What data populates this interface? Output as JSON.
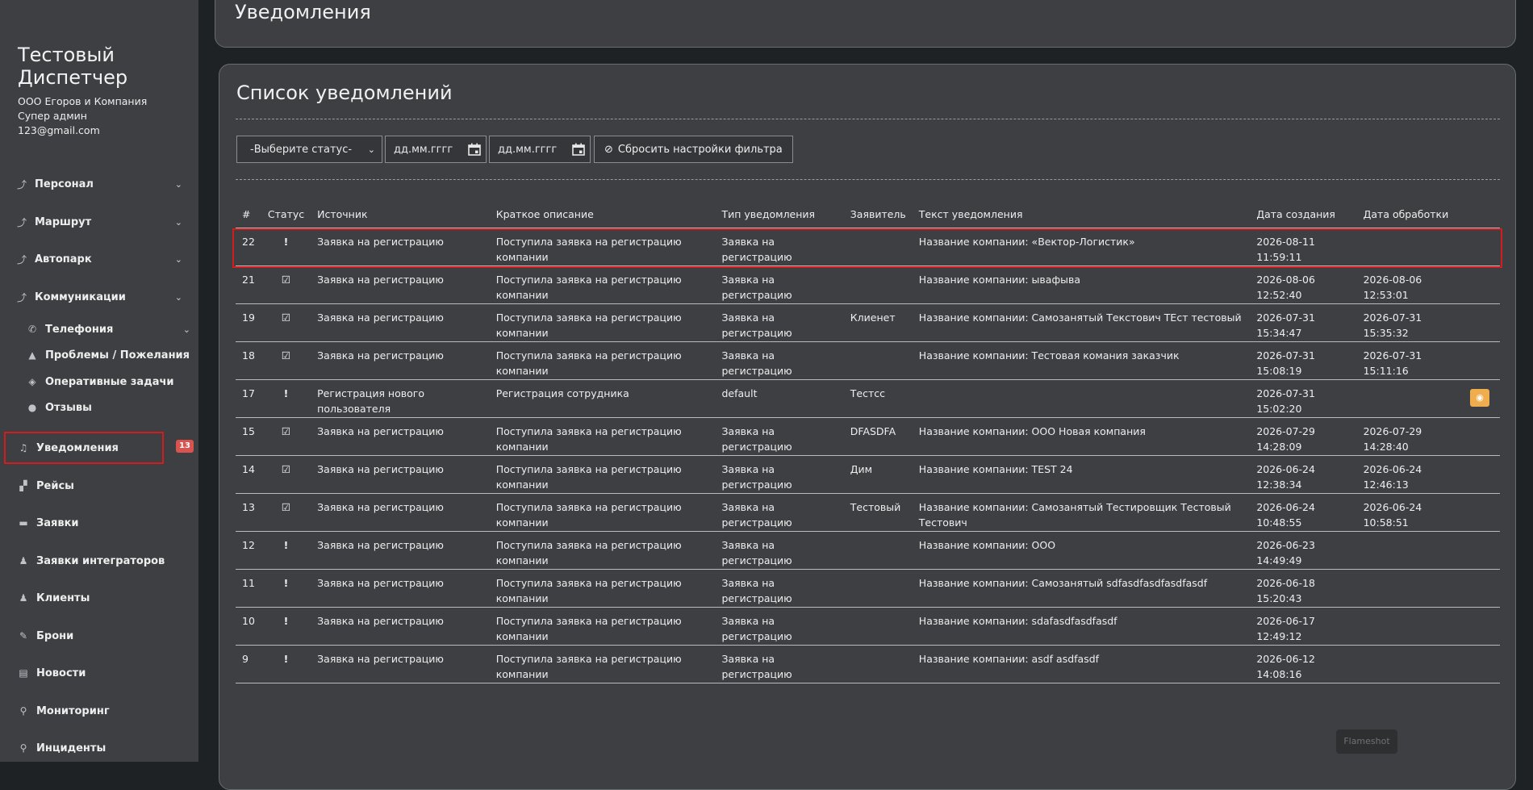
{
  "sidebar": {
    "title": "Тестовый Диспетчер",
    "company": "ООО Егоров и Компания",
    "role": "Супер админ",
    "email": "123@gmail.com",
    "items": [
      {
        "label": "Персонал",
        "icon": "arrow-up-icon"
      },
      {
        "label": "Маршрут",
        "icon": "arrow-up-icon"
      },
      {
        "label": "Автопарк",
        "icon": "arrow-up-icon"
      },
      {
        "label": "Коммуникации",
        "icon": "arrow-up-icon"
      },
      {
        "label": "Телефония",
        "icon": "phone-icon"
      },
      {
        "label": "Проблемы / Пожелания",
        "icon": "warning-icon"
      },
      {
        "label": "Оперативные задачи",
        "icon": "diamond-icon"
      },
      {
        "label": "Отзывы",
        "icon": "comment-icon"
      },
      {
        "label": "Уведомления",
        "icon": "bell-icon",
        "badge": "13"
      },
      {
        "label": "Рейсы",
        "icon": "road-icon"
      },
      {
        "label": "Заявки",
        "icon": "car-icon"
      },
      {
        "label": "Заявки интеграторов",
        "icon": "users-icon"
      },
      {
        "label": "Клиенты",
        "icon": "users-icon"
      },
      {
        "label": "Брони",
        "icon": "edit-icon"
      },
      {
        "label": "Новости",
        "icon": "newspaper-icon"
      },
      {
        "label": "Мониторинг",
        "icon": "map-marker-icon"
      },
      {
        "label": "Инциденты",
        "icon": "map-marker-icon"
      }
    ]
  },
  "header": {
    "title": "Уведомления"
  },
  "main": {
    "title": "Список уведомлений",
    "filters": {
      "status_select": "-Выберите статус-",
      "date_from": "дд.мм.гггг",
      "date_to": "дд.мм.гггг",
      "reset_label": "Сбросить настройки фильтра"
    },
    "table": {
      "columns": [
        "#",
        "Статус",
        "Источник",
        "Краткое описание",
        "Тип уведомления",
        "Заявитель",
        "Текст уведомления",
        "Дата создания",
        "Дата обработки"
      ],
      "rows": [
        {
          "id": "22",
          "status": "new",
          "source": "Заявка на регистрацию",
          "desc": "Поступила заявка на регистрацию компании",
          "type": "Заявка на регистрацию",
          "applicant": "",
          "text": "Название компании: «Вектор-Логистик»",
          "created": "2026-08-11 11:59:11",
          "processed": ""
        },
        {
          "id": "21",
          "status": "done",
          "source": "Заявка на регистрацию",
          "desc": "Поступила заявка на регистрацию компании",
          "type": "Заявка на регистрацию",
          "applicant": "",
          "text": "Название компании: ывафыва",
          "created": "2026-08-06 12:52:40",
          "processed": "2026-08-06 12:53:01"
        },
        {
          "id": "19",
          "status": "done",
          "source": "Заявка на регистрацию",
          "desc": "Поступила заявка на регистрацию компании",
          "type": "Заявка на регистрацию",
          "applicant": "Клиенет",
          "text": "Название компании: Самозанятый Текстович ТЕст тестовый",
          "created": "2026-07-31 15:34:47",
          "processed": "2026-07-31 15:35:32"
        },
        {
          "id": "18",
          "status": "done",
          "source": "Заявка на регистрацию",
          "desc": "Поступила заявка на регистрацию компании",
          "type": "Заявка на регистрацию",
          "applicant": "",
          "text": "Название компании: Тестовая комания заказчик",
          "created": "2026-07-31 15:08:19",
          "processed": "2026-07-31 15:11:16"
        },
        {
          "id": "17",
          "status": "new",
          "source": "Регистрация нового пользователя",
          "desc": "Регистрация сотрудника",
          "type": "default",
          "applicant": "Тестсс",
          "text": "",
          "created": "2026-07-31 15:02:20",
          "processed": "",
          "action": true
        },
        {
          "id": "15",
          "status": "done",
          "source": "Заявка на регистрацию",
          "desc": "Поступила заявка на регистрацию компании",
          "type": "Заявка на регистрацию",
          "applicant": "DFASDFA",
          "text": "Название компании: ООО Новая компания",
          "created": "2026-07-29 14:28:09",
          "processed": "2026-07-29 14:28:40"
        },
        {
          "id": "14",
          "status": "done",
          "source": "Заявка на регистрацию",
          "desc": "Поступила заявка на регистрацию компании",
          "type": "Заявка на регистрацию",
          "applicant": "Дим",
          "text": "Название компании: TEST 24",
          "created": "2026-06-24 12:38:34",
          "processed": "2026-06-24 12:46:13"
        },
        {
          "id": "13",
          "status": "done",
          "source": "Заявка на регистрацию",
          "desc": "Поступила заявка на регистрацию компании",
          "type": "Заявка на регистрацию",
          "applicant": "Тестовый",
          "text": "Название компании: Самозанятый Тестировщик Тестовый Тестович",
          "created": "2026-06-24 10:48:55",
          "processed": "2026-06-24 10:58:51"
        },
        {
          "id": "12",
          "status": "new",
          "source": "Заявка на регистрацию",
          "desc": "Поступила заявка на регистрацию компании",
          "type": "Заявка на регистрацию",
          "applicant": "",
          "text": "Название компании: ООО",
          "created": "2026-06-23 14:49:49",
          "processed": ""
        },
        {
          "id": "11",
          "status": "new",
          "source": "Заявка на регистрацию",
          "desc": "Поступила заявка на регистрацию компании",
          "type": "Заявка на регистрацию",
          "applicant": "",
          "text": "Название компании: Самозанятый sdfasdfasdfasdfasdf",
          "created": "2026-06-18 15:20:43",
          "processed": ""
        },
        {
          "id": "10",
          "status": "new",
          "source": "Заявка на регистрацию",
          "desc": "Поступила заявка на регистрацию компании",
          "type": "Заявка на регистрацию",
          "applicant": "",
          "text": "Название компании: sdafasdfasdfasdf",
          "created": "2026-06-17 12:49:12",
          "processed": ""
        },
        {
          "id": "9",
          "status": "new",
          "source": "Заявка на регистрацию",
          "desc": "Поступила заявка на регистрацию компании",
          "type": "Заявка на регистрацию",
          "applicant": "",
          "text": "Название компании: asdf asdfasdf",
          "created": "2026-06-12 14:08:16",
          "processed": ""
        }
      ]
    }
  },
  "watermark": "Flameshot"
}
